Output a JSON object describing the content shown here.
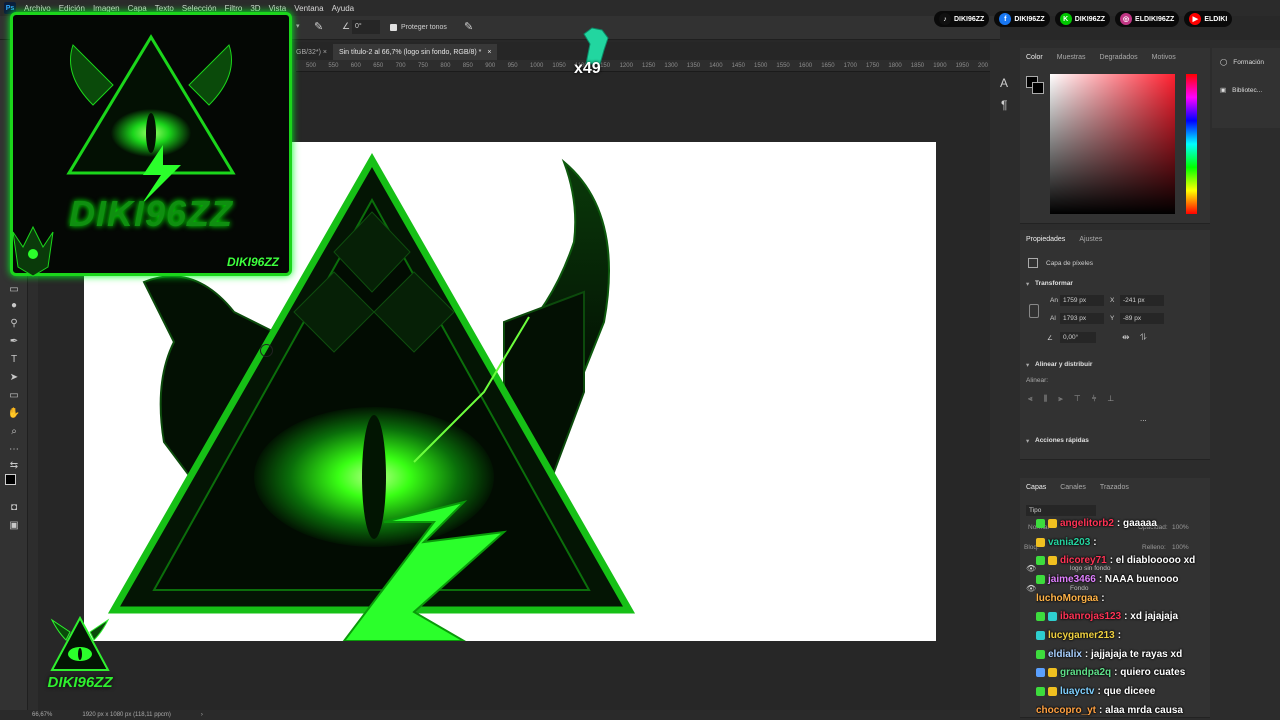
{
  "menubar": {
    "app_icon": "Ps",
    "items": [
      "Archivo",
      "Edición",
      "Imagen",
      "Capa",
      "Texto",
      "Selección",
      "Filtro",
      "3D",
      "Vista",
      "Ventana",
      "Ayuda"
    ]
  },
  "options_bar": {
    "angle_value": "0°",
    "protect_tones_label": "Proteger tonos"
  },
  "document_tabs": {
    "inactive_tab": "GB/32*) ×",
    "active_tab": "Sin título-2 al 66,7% (logo sin fondo, RGB/8) *",
    "close_glyph": "×"
  },
  "ruler_ticks": [
    "500",
    "550",
    "600",
    "650",
    "700",
    "750",
    "800",
    "850",
    "900",
    "950",
    "1000",
    "1050",
    "1100",
    "1150",
    "1200",
    "1250",
    "1300",
    "1350",
    "1400",
    "1450",
    "1500",
    "1550",
    "1600",
    "1650",
    "1700",
    "1750",
    "1800",
    "1850",
    "1900",
    "1950",
    "200"
  ],
  "status_bar": {
    "zoom": "66,67%",
    "doc_size": "1920 px x 1080 px (118,11 ppcm)",
    "arrow": "›"
  },
  "color_panel": {
    "tabs": [
      "Color",
      "Muestras",
      "Degradados",
      "Motivos"
    ],
    "hue_color": "#ff2030"
  },
  "properties_panel": {
    "tabs": [
      "Propiedades",
      "Ajustes"
    ],
    "layer_type": "Capa de píxeles",
    "transform_title": "Transformar",
    "width_label": "An",
    "width_value": "1759 px",
    "height_label": "Al",
    "height_value": "1793 px",
    "x_label": "X",
    "x_value": "-241 px",
    "y_label": "Y",
    "y_value": "-89 px",
    "angle_value": "0,00°",
    "align_title": "Alinear y distribuir",
    "align_label": "Alinear:",
    "more_glyph": "...",
    "quick_actions_title": "Acciones rápidas"
  },
  "layers_panel": {
    "tabs": [
      "Capas",
      "Canales",
      "Trazados"
    ],
    "filter_label": "Tipo",
    "blend_label": "Normal",
    "opacity_label": "Opacidad:",
    "opacity_value": "100%",
    "lock_label": "Bloq:",
    "fill_label": "Relleno:",
    "fill_value": "100%",
    "layer1": "logo sin fondo",
    "layer2": "Fondo"
  },
  "far_right_panel": {
    "items": [
      "Formación",
      "Bibliotec..."
    ]
  },
  "social_bar": [
    {
      "icon": "tiktok-icon",
      "glyph": "♪",
      "color": "#111111",
      "handle": "DIKI96ZZ"
    },
    {
      "icon": "facebook-icon",
      "glyph": "f",
      "color": "#1877f2",
      "handle": "DIKI96ZZ"
    },
    {
      "icon": "kick-icon",
      "glyph": "K",
      "color": "#00c800",
      "handle": "DIKI96ZZ"
    },
    {
      "icon": "instagram-icon",
      "glyph": "◎",
      "color": "#c13584",
      "handle": "ELDIKI96ZZ"
    },
    {
      "icon": "youtube-icon",
      "glyph": "▶",
      "color": "#ff0000",
      "handle": "ELDIKI"
    }
  ],
  "overlay_logo": {
    "brand_name": "DIKI96ZZ",
    "tag": "DIKI96ZZ"
  },
  "bottom_logo": {
    "brand_name": "DIKI96ZZ"
  },
  "counter": {
    "value": "x49"
  },
  "chat": [
    {
      "user": "angelitorb2",
      "text": ": gaaaaa",
      "color": "#ff3355",
      "badges": [
        "#3ddc3d",
        "#f0c020"
      ]
    },
    {
      "user": "vania203",
      "text": ":",
      "color": "#25d4a0",
      "badges": [
        "#f0c020"
      ]
    },
    {
      "user": "dicorey71",
      "text": ": el diablooooo xd",
      "color": "#ff3355",
      "badges": [
        "#3ddc3d",
        "#f0c020"
      ]
    },
    {
      "user": "jaime3466",
      "text": ": NAAA buenooo",
      "color": "#e080ff",
      "badges": [
        "#3ddc3d"
      ]
    },
    {
      "user": "luchoMorgaa",
      "text": ":",
      "color": "#ffb347",
      "badges": []
    },
    {
      "user": "ibanrojas123",
      "text": ": xd jajajaja",
      "color": "#ff3355",
      "badges": [
        "#3ddc3d",
        "#2ecfcf"
      ]
    },
    {
      "user": "lucygamer213",
      "text": ":",
      "color": "#f0d040",
      "badges": [
        "#2ecfcf"
      ]
    },
    {
      "user": "eldialix",
      "text": ": jajjajaja te rayas xd",
      "color": "#a8d0ff",
      "badges": [
        "#3ddc3d"
      ]
    },
    {
      "user": "grandpa2q",
      "text": ": quiero cuates",
      "color": "#5fe08a",
      "badges": [
        "#5aa0ff",
        "#f0c020"
      ]
    },
    {
      "user": "luayctv",
      "text": ": que diceee",
      "color": "#7fd0ff",
      "badges": [
        "#3ddc3d",
        "#f0c020"
      ]
    },
    {
      "user": "chocopro_yt",
      "text": ": alaa mrda causa",
      "color": "#ffa040",
      "badges": []
    }
  ]
}
